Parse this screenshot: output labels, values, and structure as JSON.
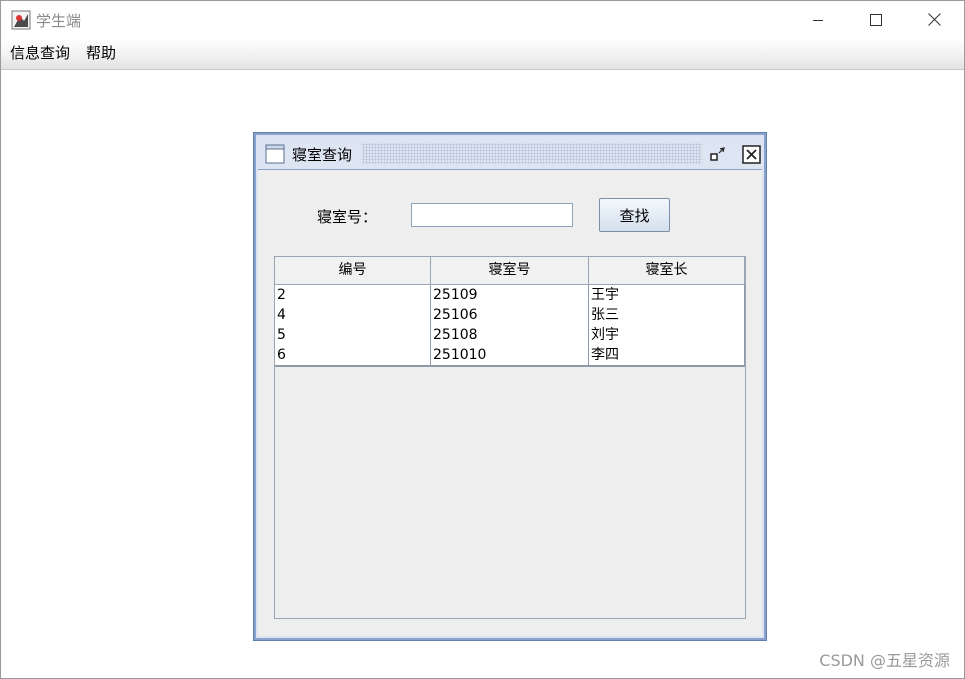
{
  "app": {
    "title": "学生端",
    "colors": {
      "internal_border": "#5f7fae",
      "title_gradient": "#dde5f3"
    }
  },
  "menu": {
    "items": [
      "信息查询",
      "帮助"
    ]
  },
  "dialog": {
    "title": "寝室查询",
    "form": {
      "label": "寝室号：",
      "input_value": "",
      "input_placeholder": "",
      "button_label": "查找"
    },
    "table": {
      "columns": [
        "编号",
        "寝室号",
        "寝室长"
      ],
      "rows": [
        [
          "2",
          "25109",
          "王宇"
        ],
        [
          "4",
          "25106",
          "张三"
        ],
        [
          "5",
          "25108",
          "刘宇"
        ],
        [
          "6",
          "251010",
          "李四"
        ]
      ]
    }
  },
  "watermark": "CSDN @五星资源"
}
